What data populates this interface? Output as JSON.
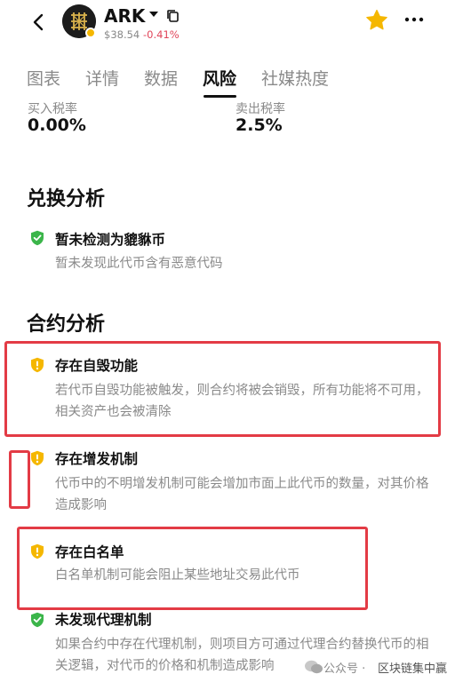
{
  "header": {
    "symbol": "ARK",
    "price": "$38.54",
    "change": "-0.41%",
    "accent": "#f5b700",
    "negative_color": "#e0455a"
  },
  "tabs": [
    {
      "label": "图表"
    },
    {
      "label": "详情"
    },
    {
      "label": "数据"
    },
    {
      "label": "风险",
      "active": true
    },
    {
      "label": "社媒热度"
    }
  ],
  "tax": {
    "buy_label": "买入税率",
    "buy_value": "0.00%",
    "sell_label": "卖出税率",
    "sell_value": "2.5%"
  },
  "exchange": {
    "title": "兑换分析",
    "items": [
      {
        "status": "safe",
        "title": "暂未检测为貔貅币",
        "desc": "暂未发现此代币含有恶意代码"
      }
    ]
  },
  "contract": {
    "title": "合约分析",
    "items": [
      {
        "status": "warning",
        "title": "存在自毁功能",
        "desc": "若代币自毁功能被触发，则合约将被会销毁，所有功能将不可用，相关资产也会被清除"
      },
      {
        "status": "warning",
        "title": "存在增发机制",
        "desc": "代币中的不明增发机制可能会增加市面上此代币的数量，对其价格造成影响"
      },
      {
        "status": "warning",
        "title": "存在白名单",
        "desc": "白名单机制可能会阻止某些地址交易此代币"
      },
      {
        "status": "safe",
        "title": "未发现代理机制",
        "desc": "如果合约中存在代理机制，则项目方可通过代理合约替换代币的相关逻辑，对代币的价格和机制造成影响"
      }
    ]
  },
  "watermark": {
    "source": "公众号",
    "separator": "·",
    "name": "区块链集中赢"
  },
  "colors": {
    "safe": "#3bb54a",
    "warning": "#f5b700",
    "highlight_box": "#e33b45"
  }
}
